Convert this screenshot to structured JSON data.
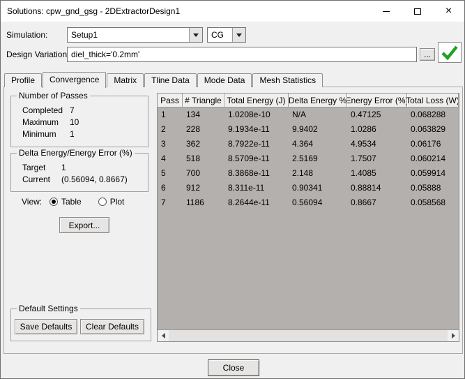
{
  "window": {
    "title": "Solutions: cpw_gnd_gsg - 2DExtractorDesign1",
    "close_glyph": "×"
  },
  "toolbar": {
    "simulation_label": "Simulation:",
    "setup_value": "Setup1",
    "matrix_value": "CG",
    "design_variation_label": "Design Variation:",
    "design_variation_value": "diel_thick='0.2mm'",
    "browse_label": "..."
  },
  "tabs": [
    {
      "label": "Profile"
    },
    {
      "label": "Convergence"
    },
    {
      "label": "Matrix"
    },
    {
      "label": "Tline Data"
    },
    {
      "label": "Mode Data"
    },
    {
      "label": "Mesh Statistics"
    }
  ],
  "passes_group": {
    "title": "Number of Passes",
    "rows": [
      {
        "label": "Completed",
        "value": "7"
      },
      {
        "label": "Maximum",
        "value": "10"
      },
      {
        "label": "Minimum",
        "value": "1"
      }
    ]
  },
  "delta_group": {
    "title": "Delta Energy/Energy Error (%)",
    "rows": [
      {
        "label": "Target",
        "value": "1"
      },
      {
        "label": "Current",
        "value": "(0.56094, 0.8667)"
      }
    ]
  },
  "view": {
    "label": "View:",
    "options": [
      {
        "label": "Table",
        "selected": true
      },
      {
        "label": "Plot",
        "selected": false
      }
    ]
  },
  "export_button": "Export...",
  "defaults_group": {
    "title": "Default Settings",
    "save_label": "Save Defaults",
    "clear_label": "Clear Defaults"
  },
  "table": {
    "headers": [
      "Pass",
      "# Triangle",
      "Total Energy (J)",
      "Delta Energy %",
      "Energy Error (%)",
      "Total Loss (W)"
    ],
    "rows": [
      [
        "1",
        "134",
        "1.0208e-10",
        "N/A",
        "0.47125",
        "0.068288"
      ],
      [
        "2",
        "228",
        "9.1934e-11",
        "9.9402",
        "1.0286",
        "0.063829"
      ],
      [
        "3",
        "362",
        "8.7922e-11",
        "4.364",
        "4.9534",
        "0.06176"
      ],
      [
        "4",
        "518",
        "8.5709e-11",
        "2.5169",
        "1.7507",
        "0.060214"
      ],
      [
        "5",
        "700",
        "8.3868e-11",
        "2.148",
        "1.4085",
        "0.059914"
      ],
      [
        "6",
        "912",
        "8.311e-11",
        "0.90341",
        "0.88814",
        "0.05888"
      ],
      [
        "7",
        "1186",
        "8.2644e-11",
        "0.56094",
        "0.8667",
        "0.058568"
      ]
    ]
  },
  "close_button": "Close"
}
